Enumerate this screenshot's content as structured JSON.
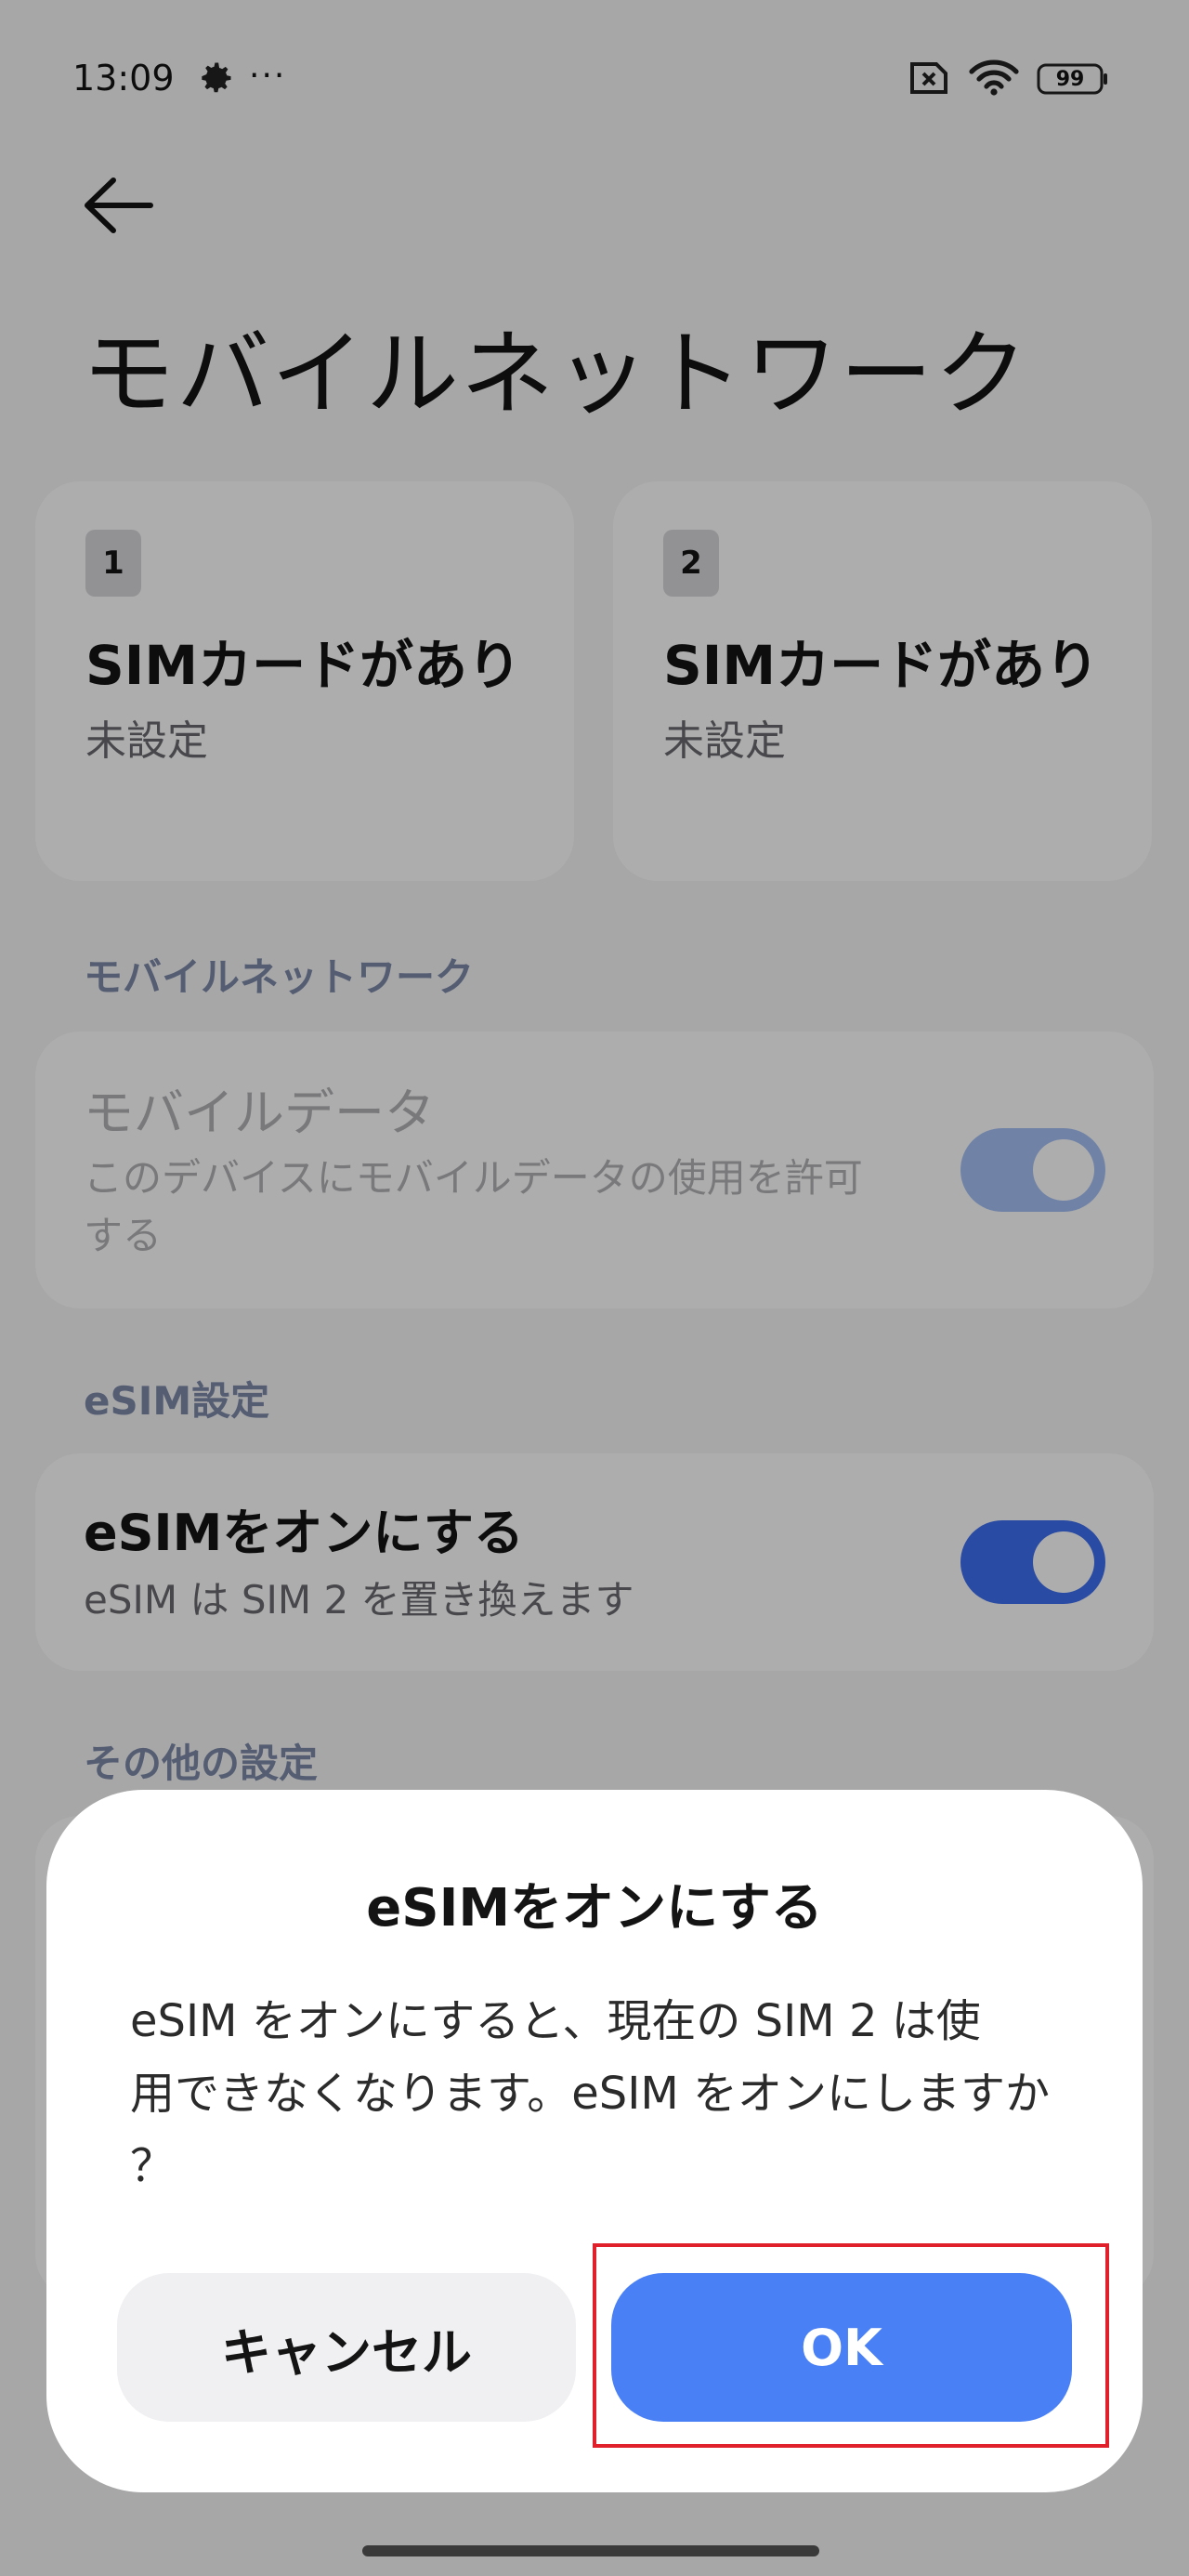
{
  "status_bar": {
    "time": "13:09",
    "more": "···",
    "battery": "99"
  },
  "page": {
    "title": "モバイルネットワーク"
  },
  "sim_cards": [
    {
      "badge": "1",
      "title": "SIMカードがあり",
      "subtitle": "未設定"
    },
    {
      "badge": "2",
      "title": "SIMカードがあり",
      "subtitle": "未設定"
    }
  ],
  "sections": {
    "mobile_network": {
      "header": "モバイルネットワーク",
      "mobile_data": {
        "title": "モバイルデータ",
        "subtitle_line1": "このデバイスにモバイルデータの使用を許可",
        "subtitle_line2": "する",
        "enabled": true
      }
    },
    "esim": {
      "header": "eSIM設定",
      "toggle_row": {
        "title": "eSIMをオンにする",
        "subtitle": "eSIM は SIM 2 を置き換えます",
        "enabled": true
      }
    },
    "other": {
      "header": "その他の設定"
    }
  },
  "dialog": {
    "title": "eSIMをオンにする",
    "message_line1": "eSIM をオンにすると、現在の SIM 2 は使",
    "message_line2": "用できなくなります。eSIM をオンにしますか",
    "message_line3": "？",
    "cancel_label": "キャンセル",
    "ok_label": "OK"
  },
  "colors": {
    "accent": "#4a80f5",
    "toggle_on": "#3d6ff0",
    "highlight": "#e0202a"
  }
}
